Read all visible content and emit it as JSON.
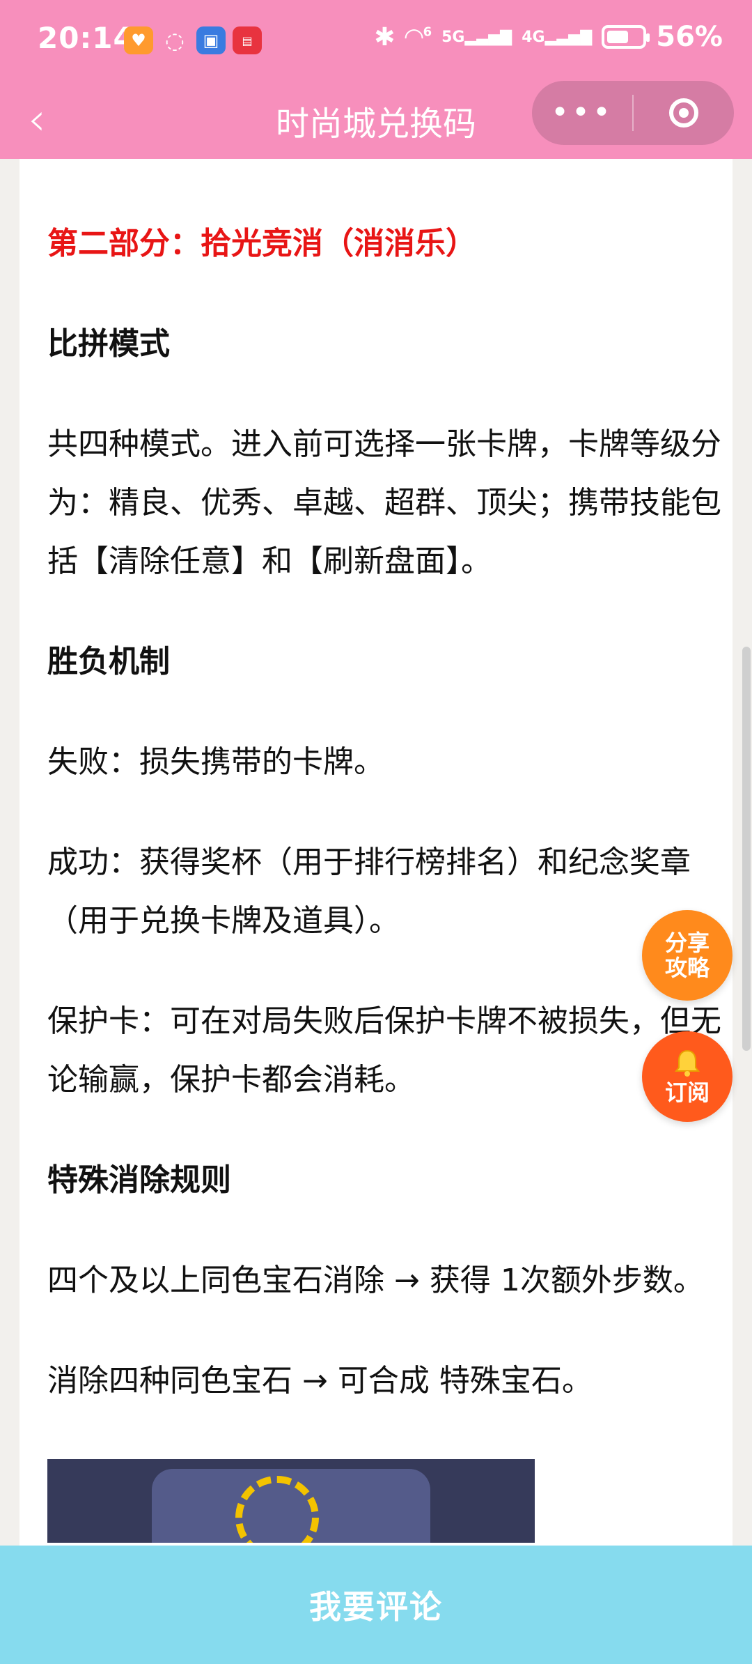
{
  "status_bar": {
    "time": "20:14",
    "battery_percent": "56%",
    "network_1": "5G",
    "network_2": "4G",
    "wifi_sup": "6",
    "icons": [
      "heart-app-icon",
      "chat-icon",
      "app-blue-icon",
      "app-red-icon",
      "bluetooth-icon",
      "wifi-icon",
      "signal-icon",
      "battery-icon"
    ]
  },
  "titlebar": {
    "back": "<",
    "title": "时尚城兑换码",
    "more": "•••"
  },
  "article": {
    "section_title": "第二部分：拾光竞消（消消乐）",
    "h_mode": "比拼模式",
    "p_mode": "共四种模式。进入前可选择一张卡牌，卡牌等级分为：精良、优秀、卓越、超群、顶尖；携带技能包括【清除任意】和【刷新盘面】。",
    "h_result": "胜负机制",
    "p_fail": "失败：损失携带的卡牌。",
    "p_success": "成功：获得奖杯（用于排行榜排名）和纪念奖章（用于兑换卡牌及道具）。",
    "p_protect": "保护卡：可在对局失败后保护卡牌不被损失，但无论输赢，保护卡都会消耗。",
    "h_rules": "特殊消除规则",
    "p_rule1": "四个及以上同色宝石消除 → 获得 1次额外步数。",
    "p_rule2": "消除四种同色宝石 → 可合成 特殊宝石。"
  },
  "fabs": {
    "share_line1": "分享",
    "share_line2": "攻略",
    "subscribe": "订阅"
  },
  "bottom": {
    "comment": "我要评论"
  },
  "colors": {
    "topbar": "#f78fbc",
    "section_title": "#e81515",
    "share": "#ff8a1c",
    "subscribe": "#ff5a1c",
    "bottom": "#86dbee"
  }
}
